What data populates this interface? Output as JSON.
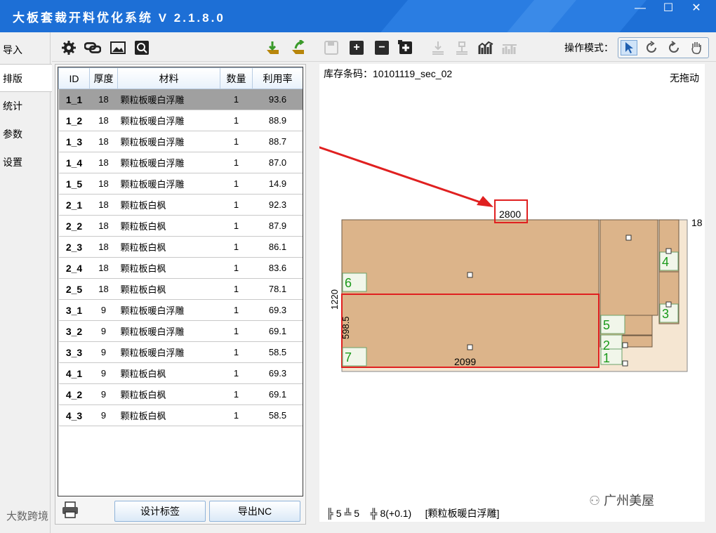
{
  "window": {
    "title": "大板套裁开料优化系统 V 2.1.8.0",
    "minimize": "—",
    "maximize": "☐",
    "close": "✕"
  },
  "nav": {
    "items": [
      "导入",
      "排版",
      "统计",
      "参数",
      "设置"
    ],
    "active": "排版"
  },
  "toolbar": {
    "icons": [
      "gear-icon",
      "link-icon",
      "image-icon",
      "scan-icon",
      "import-icon",
      "import-green-icon",
      "save-icon",
      "plus-icon",
      "minus-icon",
      "add-box-icon",
      "download-icon",
      "upload-icon",
      "chart-icon",
      "chart2-icon"
    ],
    "op_mode_label": "操作模式：",
    "op_mode_buttons": [
      "pointer-icon",
      "rotate-cw-icon",
      "rotate-icon",
      "hand-icon"
    ]
  },
  "table": {
    "headers": [
      "ID",
      "厚度",
      "材料",
      "数量",
      "利用率"
    ],
    "rows": [
      {
        "id": "1_1",
        "thick": "18",
        "mat": "颗粒板暖白浮雕",
        "qty": "1",
        "rate": "93.6",
        "selected": true
      },
      {
        "id": "1_2",
        "thick": "18",
        "mat": "颗粒板暖白浮雕",
        "qty": "1",
        "rate": "88.9"
      },
      {
        "id": "1_3",
        "thick": "18",
        "mat": "颗粒板暖白浮雕",
        "qty": "1",
        "rate": "88.7"
      },
      {
        "id": "1_4",
        "thick": "18",
        "mat": "颗粒板暖白浮雕",
        "qty": "1",
        "rate": "87.0"
      },
      {
        "id": "1_5",
        "thick": "18",
        "mat": "颗粒板暖白浮雕",
        "qty": "1",
        "rate": "14.9"
      },
      {
        "id": "2_1",
        "thick": "18",
        "mat": "颗粒板白枫",
        "qty": "1",
        "rate": "92.3"
      },
      {
        "id": "2_2",
        "thick": "18",
        "mat": "颗粒板白枫",
        "qty": "1",
        "rate": "87.9"
      },
      {
        "id": "2_3",
        "thick": "18",
        "mat": "颗粒板白枫",
        "qty": "1",
        "rate": "86.1"
      },
      {
        "id": "2_4",
        "thick": "18",
        "mat": "颗粒板白枫",
        "qty": "1",
        "rate": "83.6"
      },
      {
        "id": "2_5",
        "thick": "18",
        "mat": "颗粒板白枫",
        "qty": "1",
        "rate": "78.1"
      },
      {
        "id": "3_1",
        "thick": "9",
        "mat": "颗粒板暖白浮雕",
        "qty": "1",
        "rate": "69.3"
      },
      {
        "id": "3_2",
        "thick": "9",
        "mat": "颗粒板暖白浮雕",
        "qty": "1",
        "rate": "69.1"
      },
      {
        "id": "3_3",
        "thick": "9",
        "mat": "颗粒板暖白浮雕",
        "qty": "1",
        "rate": "58.5"
      },
      {
        "id": "4_1",
        "thick": "9",
        "mat": "颗粒板白枫",
        "qty": "1",
        "rate": "69.3"
      },
      {
        "id": "4_2",
        "thick": "9",
        "mat": "颗粒板白枫",
        "qty": "1",
        "rate": "69.1"
      },
      {
        "id": "4_3",
        "thick": "9",
        "mat": "颗粒板白枫",
        "qty": "1",
        "rate": "58.5"
      }
    ]
  },
  "buttons": {
    "design_label": "设计标签",
    "export_nc": "导出NC"
  },
  "canvas": {
    "barcode": "库存条码：10101119_sec_02",
    "drag_mode": "无拖动",
    "dim_width": "2800",
    "dim_thickness": "18",
    "dim_height": "1220",
    "dim_part_height": "598.5",
    "dim_part_width": "2099",
    "part_labels": [
      "6",
      "7",
      "5",
      "4",
      "3",
      "2",
      "1"
    ],
    "status_a": "╠ 5 ╩ 5",
    "status_b": "╬ 8(+0.1)",
    "status_mat": "[颗粒板暖白浮雕]",
    "watermark": "广州美屋",
    "watermark2": "大数跨境"
  },
  "colors": {
    "titlebar": "#1d6fd6",
    "panel_fill": "#dcb48a",
    "highlight": "#e02020",
    "label_green": "#1a9a1a"
  }
}
